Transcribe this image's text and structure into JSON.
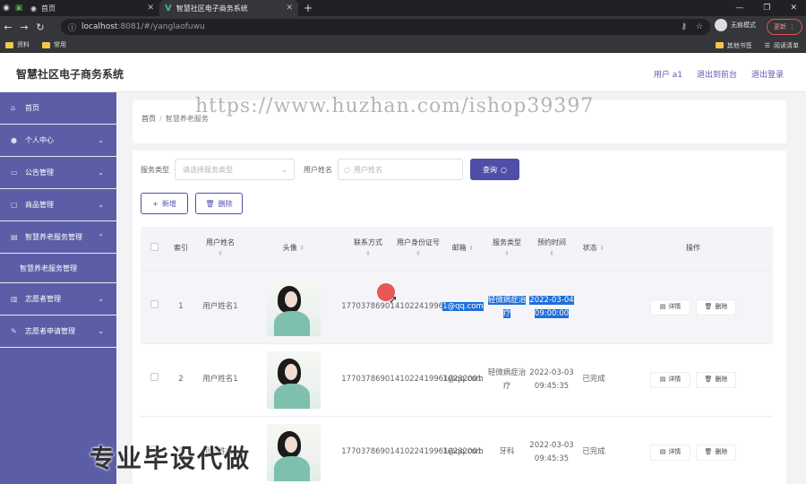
{
  "browser": {
    "tabs": [
      {
        "label": "首页",
        "active": false
      },
      {
        "label": "智慧社区电子商务系统",
        "active": true
      }
    ],
    "url_host": "localhost",
    "url_rest": ":8081/#/yanglaofuwu",
    "incognito_label": "无痕模式",
    "update_label": "更新",
    "bookmarks": [
      "资料",
      "常用"
    ],
    "bookmarks_right": [
      "其他书签",
      "阅读清单"
    ]
  },
  "header": {
    "title": "智慧社区电子商务系统",
    "user": "用户 a1",
    "back_front": "退出到前台",
    "logout": "退出登录"
  },
  "sidebar": {
    "items": [
      {
        "label": "首页",
        "icon": "home-icon"
      },
      {
        "label": "个人中心",
        "icon": "user-icon"
      },
      {
        "label": "公告管理",
        "icon": "notice-icon"
      },
      {
        "label": "商品管理",
        "icon": "goods-icon"
      },
      {
        "label": "智慧养老服务管理",
        "icon": "service-icon"
      },
      {
        "label": "志愿者管理",
        "icon": "volunteer-icon"
      },
      {
        "label": "志愿者申请管理",
        "icon": "apply-icon"
      }
    ],
    "submenu": "智慧养老服务管理"
  },
  "breadcrumb": {
    "home": "首页",
    "current": "智慧养老服务"
  },
  "search": {
    "type_label": "服务类型",
    "type_placeholder": "请选择服务类型",
    "name_label": "用户姓名",
    "name_placeholder": "用户姓名",
    "query_button": "查询"
  },
  "actions": {
    "add": "新增",
    "delete": "删除"
  },
  "table": {
    "headers": {
      "index": "索引",
      "username": "用户姓名",
      "avatar": "头像",
      "phone": "联系方式",
      "idcard": "用户身份证号",
      "email": "邮箱",
      "service": "服务类型",
      "time": "预约时间",
      "status": "状态",
      "ops": "操作"
    },
    "rows": [
      {
        "index": "1",
        "username": "用户姓名1",
        "phone": "17703786901",
        "idcard": "410224199610232001",
        "email": "1@qq.com",
        "service": "轻微病症治疗",
        "time": "2022-03-04 09:00:00",
        "status": ""
      },
      {
        "index": "2",
        "username": "用户姓名1",
        "phone": "17703786901",
        "idcard": "410224199610232001",
        "email": "1@qq.com",
        "service": "轻微病症治疗",
        "time": "2022-03-03 09:45:35",
        "status": "已完成"
      },
      {
        "index": "3",
        "username": "用户姓名1",
        "phone": "17703786901",
        "idcard": "410224199610232001",
        "email": "1@qq.com",
        "service": "牙科",
        "time": "2022-03-03 09:45:35",
        "status": "已完成"
      }
    ],
    "detail_label": "详情",
    "delete_label": "删除"
  },
  "watermark": {
    "url": "https://www.huzhan.com/ishop39397",
    "slogan": "专业毕设代做"
  }
}
